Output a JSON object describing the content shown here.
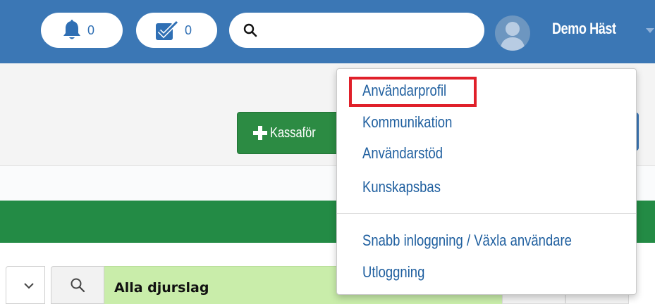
{
  "topbar": {
    "color": "#3b77b5",
    "notifications": {
      "icon": "bell-icon",
      "count": "0"
    },
    "tasks": {
      "icon": "checkbox-icon",
      "count": "0"
    },
    "search": {
      "icon": "search-icon",
      "value": "",
      "placeholder": ""
    },
    "user": {
      "avatar": "user-avatar-icon",
      "name": "Demo Häst",
      "caret": "caret-down-icon"
    }
  },
  "toolbar": {
    "new_sale_button": {
      "icon": "plus-icon",
      "label": "Kassaför"
    }
  },
  "filter": {
    "select_icon": "chevron-down-icon",
    "search_icon": "search-icon",
    "species_value": "Alla djurslag"
  },
  "user_menu": {
    "items": [
      {
        "label": "Användarprofil",
        "highlighted": true
      },
      {
        "label": "Kommunikation"
      },
      {
        "label": "Användarstöd"
      },
      {
        "label": "Kunskapsbas"
      }
    ],
    "secondary_items": [
      {
        "label": "Snabb inloggning / Växla användare"
      },
      {
        "label": "Utloggning"
      }
    ]
  },
  "colors": {
    "accent_blue": "#3b77b5",
    "link_blue": "#1f5f9f",
    "success_green": "#238b45",
    "highlight_red": "#e0202a",
    "field_green": "#c9edaa"
  }
}
